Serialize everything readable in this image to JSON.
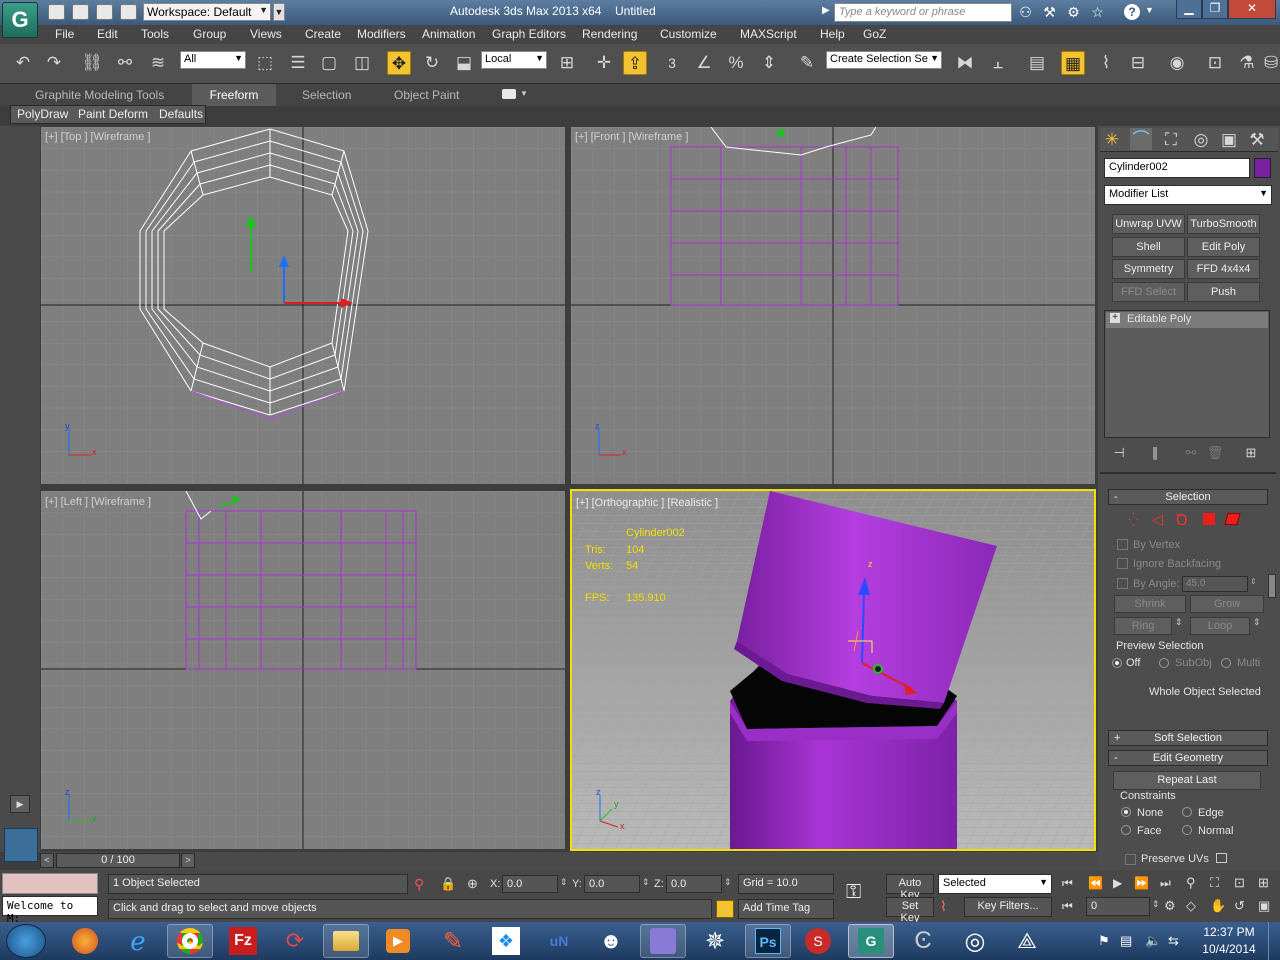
{
  "app": {
    "title": "Autodesk 3ds Max  2013 x64",
    "document": "Untitled",
    "logo_glyph": "G",
    "workspace": "Workspace: Default",
    "search_placeholder": "Type a keyword or phrase",
    "help_icon": "?"
  },
  "menu": [
    "File",
    "Edit",
    "Tools",
    "Group",
    "Views",
    "Create",
    "Modifiers",
    "Animation",
    "Graph Editors",
    "Rendering",
    "Customize",
    "MAXScript",
    "Help",
    "GoZ"
  ],
  "toolbar": {
    "filter": "All",
    "coord_system": "Local",
    "snap_label": "3",
    "selection_set": "Create Selection Se"
  },
  "ribbon": {
    "tabs": [
      "Graphite Modeling Tools",
      "Freeform",
      "Selection",
      "Object Paint"
    ],
    "active": "Freeform",
    "subtabs": [
      "PolyDraw",
      "Paint Deform",
      "Defaults"
    ]
  },
  "viewports": {
    "top": "[+] [Top ] [Wireframe ]",
    "front": "[+] [Front ] [Wireframe ]",
    "left": "[+] [Left ] [Wireframe ]",
    "persp": "[+] [Orthographic ] [Realistic ]"
  },
  "stats": {
    "object": "Cylinder002",
    "tris_label": "Tris:",
    "tris": "104",
    "verts_label": "Verts:",
    "verts": "54",
    "fps_label": "FPS:",
    "fps": "135.910"
  },
  "axis_labels": {
    "x": "x",
    "y": "y",
    "z": "z"
  },
  "panel": {
    "object_name": "Cylinder002",
    "object_color": "#7a1fa0",
    "modifier_list": "Modifier List",
    "modifiers": [
      "Unwrap UVW",
      "TurboSmooth",
      "Shell",
      "Edit Poly",
      "Symmetry",
      "FFD 4x4x4",
      "FFD Select",
      "Push"
    ],
    "stack_item": "Editable Poly",
    "selection_title": "Selection",
    "by_vertex": "By Vertex",
    "ignore_backfacing": "Ignore Backfacing",
    "by_angle": "By Angle:",
    "angle_value": "45.0",
    "shrink": "Shrink",
    "grow": "Grow",
    "ring": "Ring",
    "loop": "Loop",
    "preview_title": "Preview Selection",
    "preview_off": "Off",
    "preview_subobj": "SubObj",
    "preview_multi": "Multi",
    "whole_object": "Whole Object Selected",
    "soft_selection": "Soft Selection",
    "edit_geometry": "Edit Geometry",
    "repeat_last": "Repeat Last",
    "constraints": "Constraints",
    "c_none": "None",
    "c_edge": "Edge",
    "c_face": "Face",
    "c_normal": "Normal",
    "preserve_uvs": "Preserve UVs",
    "plus": "+",
    "minus": "-"
  },
  "status": {
    "timeline": "0 / 100",
    "welcome": "Welcome to M:",
    "selected": "1 Object Selected",
    "prompt": "Click and drag to select and move objects",
    "x_label": "X:",
    "x": "0.0",
    "y_label": "Y:",
    "y": "0.0",
    "z_label": "Z:",
    "z": "0.0",
    "grid": "Grid = 10.0",
    "add_time_tag": "Add Time Tag",
    "auto_key": "Auto Key",
    "key_mode": "Selected",
    "set_key": "Set Key",
    "key_filters": "Key Filters...",
    "frame": "0"
  },
  "taskbar": {
    "time": "12:37 PM",
    "date": "10/4/2014"
  },
  "colors": {
    "purple": "#9b27c7",
    "viewport_bg": "#7f7f7f",
    "active_border": "#f0e000",
    "accent": "#f2c230"
  }
}
